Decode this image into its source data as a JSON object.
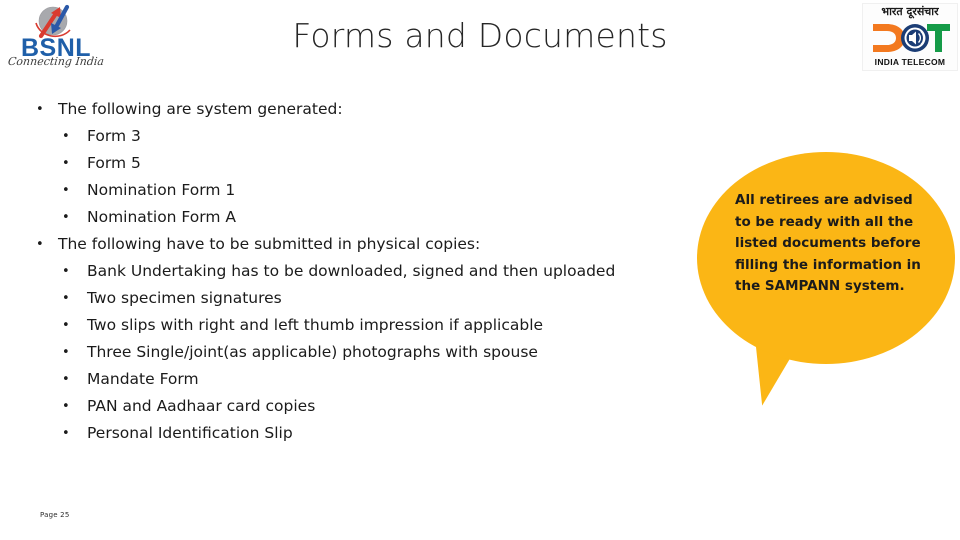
{
  "slide": {
    "title": "Forms and Documents",
    "page_number": "Page 25",
    "background_color": "#FFFFFF"
  },
  "brand_left": {
    "name": "BSNL",
    "tagline": "Connecting India",
    "emblem_icon": "bsnl-arrows-globe-icon",
    "wordmark_color": "#1F5FA9",
    "arrow_red": "#D93B30",
    "arrow_blue": "#2B59A8",
    "globe_gray": "#A8A9AD"
  },
  "brand_right": {
    "hindi_text": "भारत दूरसंचार",
    "wordmark": "DOT",
    "subtitle": "INDIA TELECOM",
    "logo_icon": "dot-india-telecom-icon",
    "color_orange": "#F3791F",
    "color_navy": "#1B3D75",
    "color_green": "#159B48"
  },
  "content": {
    "bullets": [
      {
        "level": 1,
        "marker": "•",
        "text": "The following are system generated:"
      },
      {
        "level": 2,
        "marker": "•",
        "text": "Form 3"
      },
      {
        "level": 2,
        "marker": "•",
        "text": "Form 5"
      },
      {
        "level": 2,
        "marker": "•",
        "text": "Nomination Form 1"
      },
      {
        "level": 2,
        "marker": "•",
        "text": "Nomination Form A"
      },
      {
        "level": 1,
        "marker": "•",
        "text": "The following have to be submitted in physical copies:"
      },
      {
        "level": 2,
        "marker": "•",
        "text": "Bank Undertaking has to be downloaded, signed and then uploaded"
      },
      {
        "level": 2,
        "marker": "•",
        "text": "Two specimen signatures"
      },
      {
        "level": 2,
        "marker": "•",
        "text": "Two slips with right and left thumb impression if applicable"
      },
      {
        "level": 2,
        "marker": "•",
        "text": "Three Single/joint(as applicable) photographs with spouse"
      },
      {
        "level": 2,
        "marker": "•",
        "text": "Mandate Form"
      },
      {
        "level": 2,
        "marker": "•",
        "text": "PAN and Aadhaar card copies"
      },
      {
        "level": 2,
        "marker": "•",
        "text": "Personal Identification Slip"
      }
    ]
  },
  "callout": {
    "text": "All retirees are advised to be ready with all the listed documents before filling the information in the SAMPANN system.",
    "fill_color": "#FBB615",
    "text_color": "#1B1B1B",
    "shape": "speech-balloon-ellipse-with-tail"
  }
}
